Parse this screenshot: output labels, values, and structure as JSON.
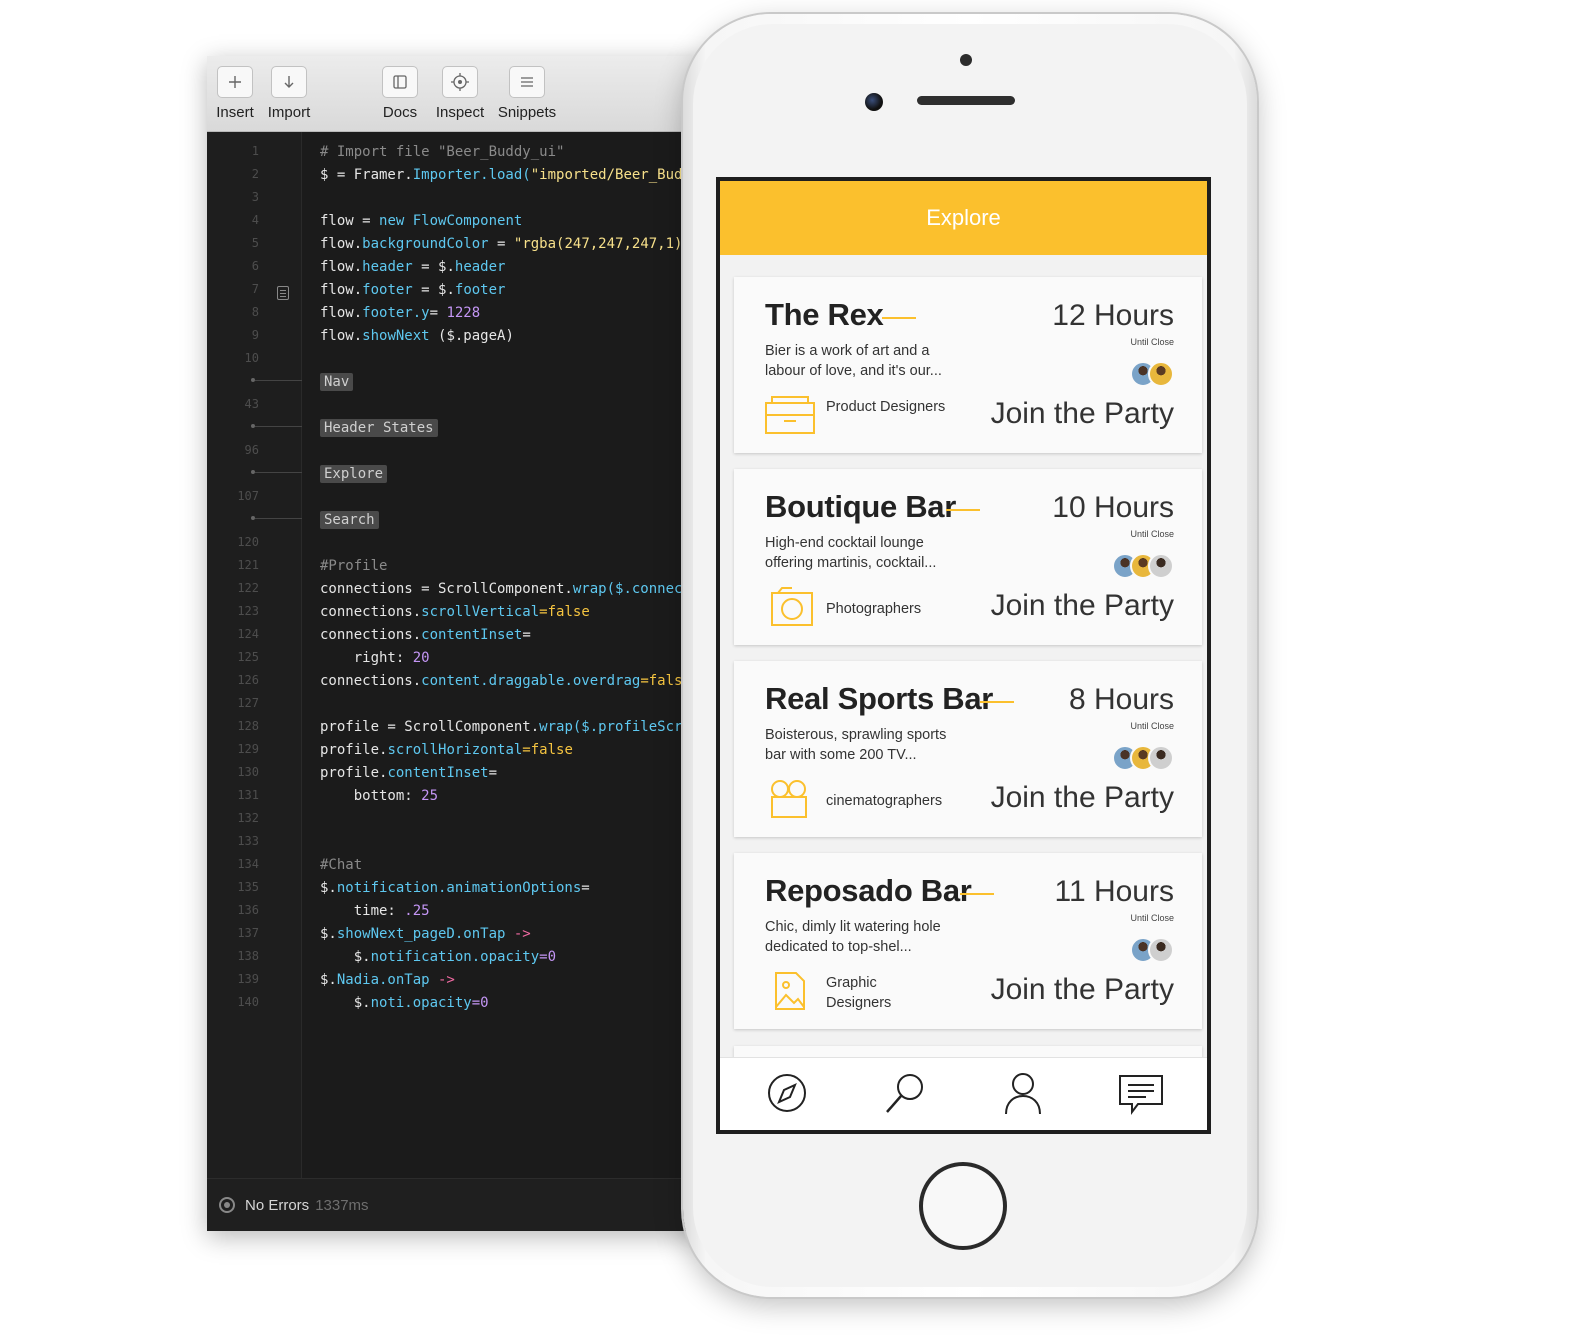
{
  "toolbar": {
    "insert": "Insert",
    "import": "Import",
    "docs": "Docs",
    "inspect": "Inspect",
    "snippets": "Snippets"
  },
  "editor": {
    "line_numbers": [
      "1",
      "2",
      "3",
      "4",
      "5",
      "6",
      "7",
      "8",
      "9",
      "10",
      "43",
      "96",
      "107",
      "120",
      "121",
      "122",
      "123",
      "124",
      "125",
      "126",
      "127",
      "128",
      "129",
      "130",
      "131",
      "132",
      "133",
      "134",
      "135",
      "136",
      "137",
      "138",
      "139",
      "140"
    ],
    "folds": [
      "Nav",
      "Header States",
      "Explore",
      "Search"
    ],
    "code": {
      "l1": "# Import file \"Beer_Buddy_ui\"",
      "l2a": "$ = Framer.",
      "l2b": "Importer.load(",
      "l2c": "\"imported/Beer_Buddy_",
      "l4a": "flow = ",
      "l4b": "new FlowComponent",
      "l5a": "flow.",
      "l5b": "backgroundColor",
      "l5c": " = ",
      "l5d": "\"rgba(247,247,247,1)\"",
      "l6a": "flow.",
      "l6b": "header",
      "l6c": " = $.",
      "l6d": "header",
      "l7a": "flow.",
      "l7b": "footer",
      "l7c": " = $.",
      "l7d": "footer",
      "l8a": "flow.",
      "l8b": "footer.y",
      "l8c": "= ",
      "l8d": "1228",
      "l9a": "flow.",
      "l9b": "showNext",
      "l9c": " ($.pageA)",
      "l121": "#Profile",
      "l122a": "connections = ScrollComponent.",
      "l122b": "wrap($.connection",
      "l123a": "connections.",
      "l123b": "scrollVertical",
      "l123c": "=false",
      "l124a": "connections.",
      "l124b": "contentInset",
      "l124c": "=",
      "l125a": "    right: ",
      "l125b": "20",
      "l126a": "connections.",
      "l126b": "content.draggable.overdrag",
      "l126c": "=false",
      "l128a": "profile = ScrollComponent.",
      "l128b": "wrap($.profileScroll",
      "l129a": "profile.",
      "l129b": "scrollHorizontal",
      "l129c": "=false",
      "l130a": "profile.",
      "l130b": "contentInset",
      "l130c": "=",
      "l131a": "    bottom: ",
      "l131b": "25",
      "l134": "#Chat",
      "l135a": "$.",
      "l135b": "notification.animationOptions",
      "l135c": "=",
      "l136a": "    time: ",
      "l136b": ".25",
      "l137a": "$.",
      "l137b": "showNext_pageD.onTap",
      "l137c": " ->",
      "l138a": "    $.",
      "l138b": "notification.opacity",
      "l138c": "=0",
      "l139a": "$.",
      "l139b": "Nadia.onTap",
      "l139c": " ->",
      "l140a": "    $.",
      "l140b": "noti.opacity",
      "l140c": "=0"
    }
  },
  "status": {
    "label": "No Errors",
    "time": "1337ms"
  },
  "app": {
    "header_title": "Explore",
    "accent": "#fbc02d",
    "cards": [
      {
        "title": "The Rex",
        "hours": "12 Hours",
        "until": "Until Close",
        "desc": "Bier is a work of art and a labour of love, and it's our...",
        "category": "Product Designers",
        "category_icon": "wallet-icon",
        "action": "Join the Party"
      },
      {
        "title": "Boutique Bar",
        "hours": "10 Hours",
        "until": "Until Close",
        "desc": "High-end cocktail lounge offering martinis, cocktail...",
        "category": "Photographers",
        "category_icon": "camera-icon",
        "action": "Join the Party"
      },
      {
        "title": "Real Sports Bar",
        "hours": "8 Hours",
        "until": "Until Close",
        "desc": "Boisterous, sprawling sports bar with some 200 TV...",
        "category": "cinematographers",
        "category_icon": "film-camera-icon",
        "action": "Join the Party"
      },
      {
        "title": "Reposado Bar",
        "hours": "11 Hours",
        "until": "Until Close",
        "desc": "Chic, dimly lit watering hole dedicated to top-shel...",
        "category": "Graphic Designers",
        "category_icon": "image-icon",
        "action": "Join the Party"
      }
    ],
    "tabs": [
      "compass-icon",
      "search-icon",
      "profile-icon",
      "chat-icon"
    ]
  }
}
